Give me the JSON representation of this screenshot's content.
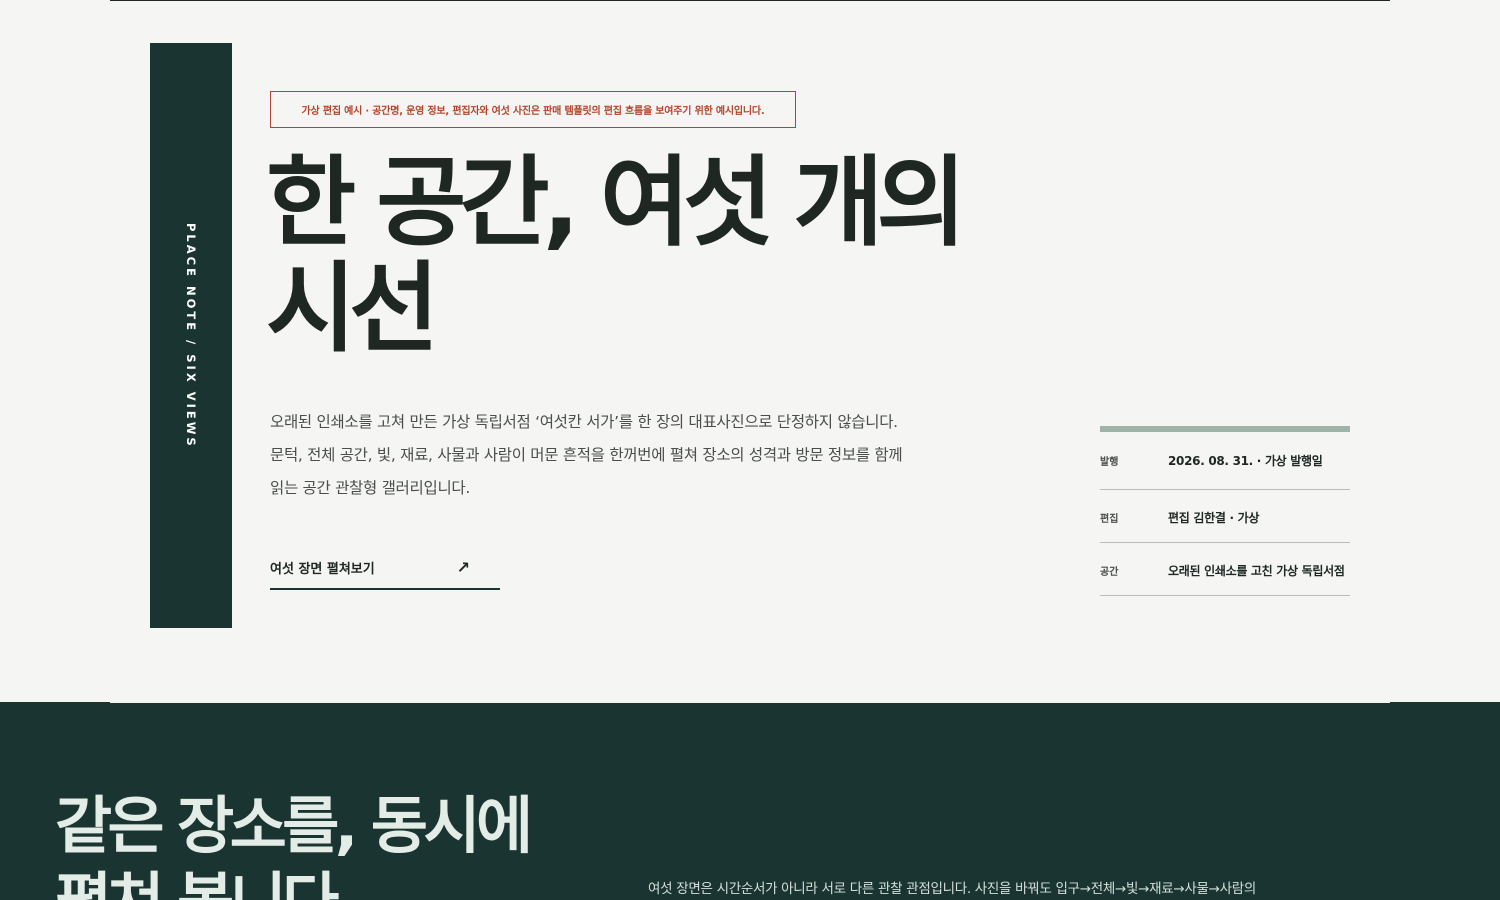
{
  "side_band": {
    "label": "PLACE NOTE / SIX VIEWS"
  },
  "notice": {
    "text": "가상 편집 예시 · 공간명, 운영 정보, 편집자와 여섯 사진은 판매 템플릿의 편집 흐름을 보여주기 위한 예시입니다."
  },
  "hero": {
    "title_lines": [
      "한 공간, 여섯 개의",
      "시선"
    ],
    "intro_lines": [
      "오래된 인쇄소를 고쳐 만든 가상 독립서점 ‘여섯칸 서가’를 한 장의 대표사진으로 단정하지 않습니다.",
      "문턱, 전체 공간, 빛, 재료, 사물과 사람이 머문 흔적을 한꺼번에 펼쳐 장소의 성격과 방문 정보를 함께",
      "읽는 공간 관찰형 갤러리입니다."
    ],
    "cta_label": "여섯 장면 펼쳐보기",
    "cta_icon": "arrow-up-right-icon"
  },
  "meta": [
    {
      "key": "발행",
      "value": "2026. 08. 31. · 가상 발행일"
    },
    {
      "key": "편집",
      "value": "편집 김한결 · 가상"
    },
    {
      "key": "공간",
      "value": "오래된 인쇄소를 고친 가상 독립서점"
    }
  ],
  "section": {
    "title_lines": [
      "같은 장소를, 동시에",
      "펼쳐 봅니다"
    ],
    "description": "여섯 장면은 시간순서가 아니라 서로 다른 관찰 관점입니다. 사진을 바꿔도 입구→전체→빛→재료→사물→사람의"
  },
  "colors": {
    "background": "#f5f5f3",
    "dark_green": "#1a3531",
    "accent_red": "#b4452c",
    "sage": "#9fb3a8",
    "ink": "#1e2724"
  }
}
